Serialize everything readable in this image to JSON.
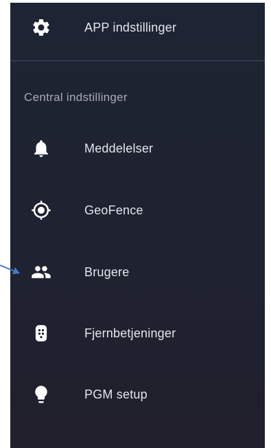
{
  "app_settings": {
    "label": "APP indstillinger",
    "icon": "gear-icon"
  },
  "central": {
    "title": "Central indstillinger",
    "items": [
      {
        "label": "Meddelelser",
        "icon": "bell-icon"
      },
      {
        "label": "GeoFence",
        "icon": "target-icon"
      },
      {
        "label": "Brugere",
        "icon": "users-icon"
      },
      {
        "label": "Fjernbetjeninger",
        "icon": "remote-icon"
      },
      {
        "label": "PGM setup",
        "icon": "lightbulb-icon"
      }
    ]
  },
  "colors": {
    "panel_background": "#1f2230",
    "text": "#e4e6ec",
    "section_title": "#a7abb6",
    "annotation_arrow": "#4a78c8"
  }
}
